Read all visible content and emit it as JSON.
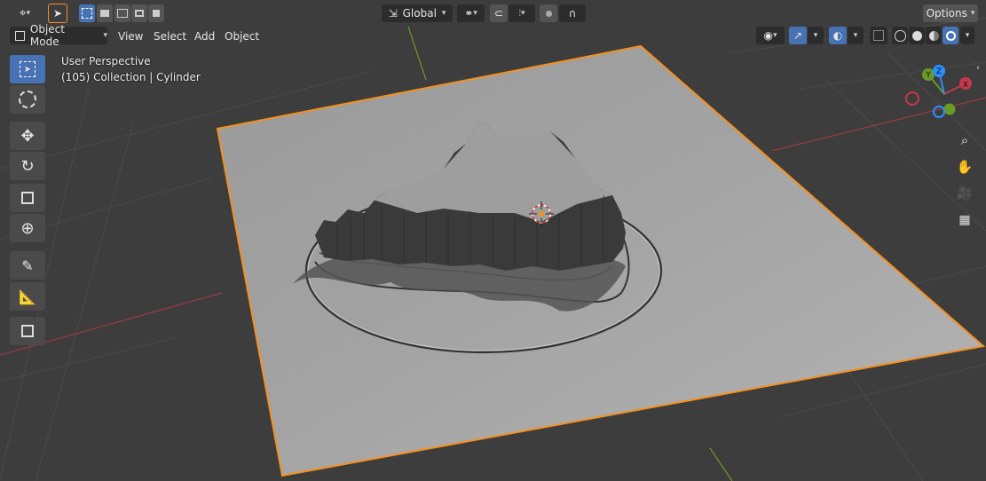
{
  "header": {
    "mode_label": "Object Mode",
    "menus": [
      "View",
      "Select",
      "Add",
      "Object"
    ],
    "orientation_label": "Global",
    "options_label": "Options"
  },
  "overlay": {
    "perspective_label": "User Perspective",
    "collection_label": "(105) Collection | Cylinder"
  },
  "gizmo": {
    "x_label": "X",
    "y_label": "Y",
    "z_label": "Z"
  },
  "colors": {
    "accent": "#4772b3",
    "selection_outline": "#f5901f",
    "x_axis": "#c6384a",
    "y_axis": "#6a9a26",
    "z_axis": "#2c8fff",
    "viewport_bg": "#3d3d3d"
  },
  "icons": {
    "editor_type": "editor-type-icon",
    "select_tool": "cursor-arrow-icon",
    "cursor": "3d-cursor-icon",
    "move": "move-icon",
    "rotate": "rotate-icon",
    "scale": "scale-icon",
    "transform": "transform-icon",
    "annotate": "annotate-icon",
    "measure": "measure-icon",
    "add_cube": "add-cube-icon",
    "zoom": "zoom-icon",
    "pan": "hand-icon",
    "camera": "camera-icon",
    "ortho": "grid-perspective-icon"
  }
}
